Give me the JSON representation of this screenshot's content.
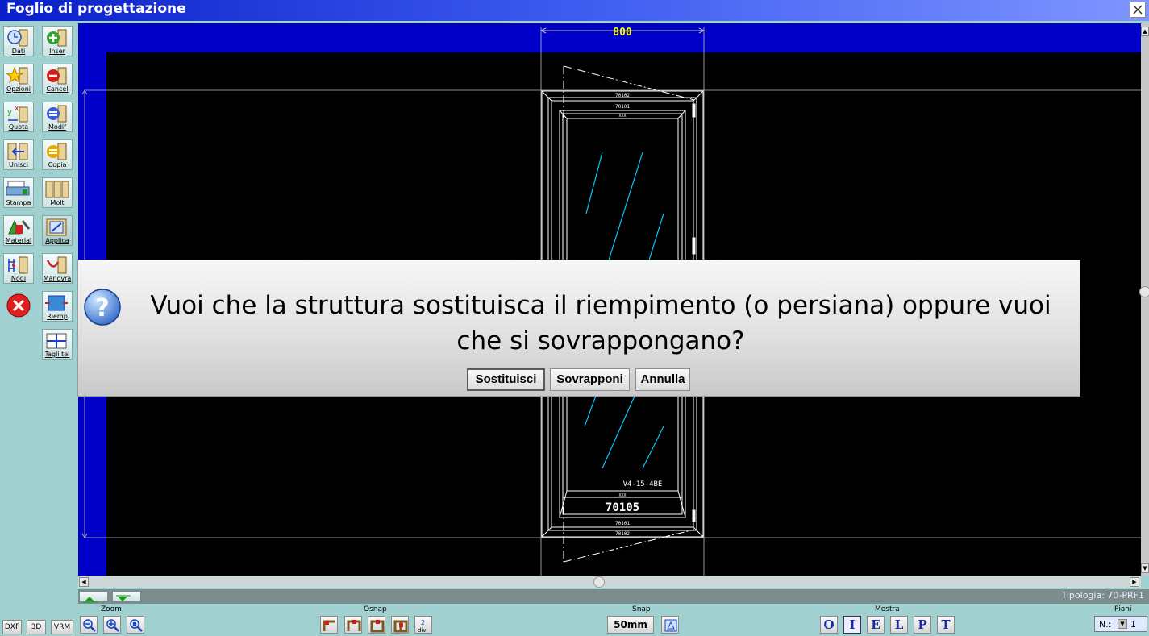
{
  "window": {
    "title": "Foglio di progettazione"
  },
  "toolbar": {
    "dati": "Dati",
    "inser": "Inser",
    "opzioni": "Opzioni",
    "cancel": "Cancel",
    "quota": "Quota",
    "modif": "Modif",
    "unisci": "Unisci",
    "copia": "Copia",
    "stampa": "Stampa",
    "molt": "Molt",
    "material": "Material",
    "applica": "Applica",
    "nodi": "Nodi",
    "manovra": "Manovra",
    "riemp": "Riemp",
    "taglitel": "Tagli tel"
  },
  "drawing": {
    "width_dimension": "800",
    "frame_top": "70102",
    "frame_top2": "70101",
    "sash_top": "XXX",
    "glass_code": "V4-15-4BE",
    "sash_bottom": "XXX",
    "panel_code": "70105",
    "frame_bottom2": "70101",
    "frame_bottom": "70102"
  },
  "layers": {
    "tipologia": "Tipologia: 70-PRF1"
  },
  "bottom": {
    "dxf": "DXF",
    "d3": "3D",
    "vrm": "VRM",
    "zoom_label": "Zoom",
    "osnap_label": "Osnap",
    "snap_label": "Snap",
    "snap_value": "50mm",
    "mostra_label": "Mostra",
    "mostra_buttons": [
      "O",
      "I",
      "E",
      "L",
      "P",
      "T"
    ],
    "piani_label": "Piani",
    "piani_n": "N.:",
    "piani_value": "1"
  },
  "dialog": {
    "message": "Vuoi che la struttura sostituisca il riempimento (o persiana) oppure vuoi che si sovrappongano?",
    "btn_sostituisci": "Sostituisci",
    "btn_sovrapponi": "Sovrapponi",
    "btn_annulla": "Annulla"
  },
  "colors": {
    "canvas_border": "#0000c8",
    "glass_lines": "#00c8ff",
    "drawing_lines": "#ffffff",
    "dimension": "#ffff00"
  }
}
